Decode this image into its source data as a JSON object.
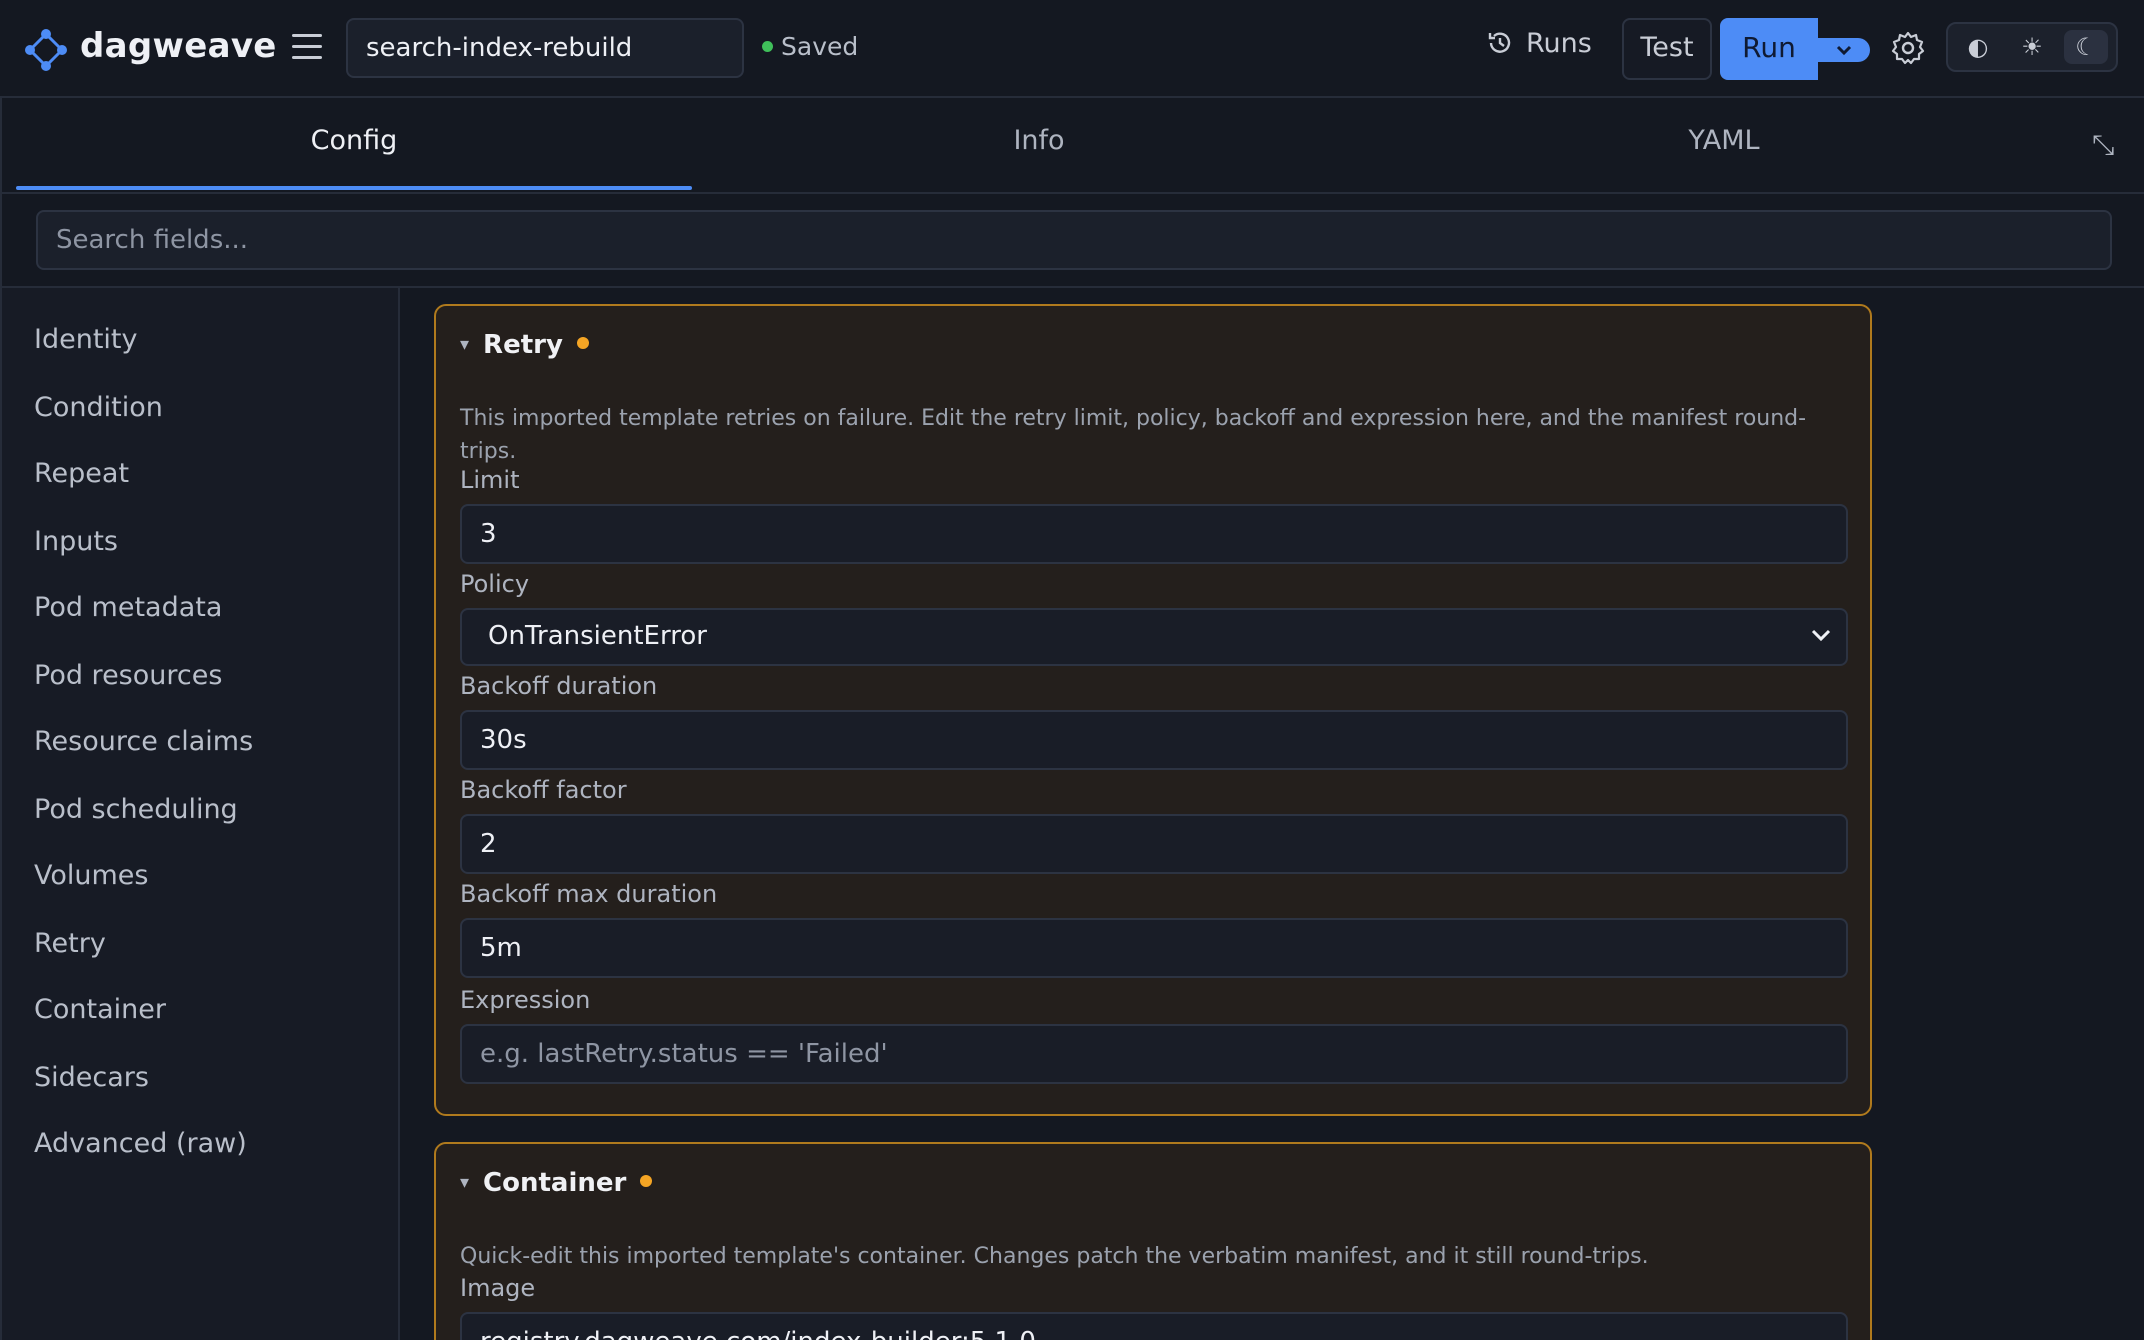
{
  "app": {
    "brand": "dagweave",
    "workflow_name": "search-index-rebuild",
    "save_status": "Saved",
    "accent": "#4d8cf6",
    "status_ok_color": "#3fbf5a",
    "modified_color": "#f5a524"
  },
  "toolbar": {
    "runs_label": "Runs",
    "test_label": "Test",
    "run_label": "Run",
    "theme_options": [
      "◐",
      "☀",
      "☾"
    ],
    "theme_active_index": 2
  },
  "tabs": [
    {
      "label": "Config",
      "active": true
    },
    {
      "label": "Info",
      "active": false
    },
    {
      "label": "YAML",
      "active": false
    }
  ],
  "collapse_icon": "⤡",
  "search": {
    "placeholder": "Search fields..."
  },
  "sidebar": {
    "items": [
      {
        "label": "Identity"
      },
      {
        "label": "Condition"
      },
      {
        "label": "Repeat"
      },
      {
        "label": "Inputs"
      },
      {
        "label": "Pod metadata"
      },
      {
        "label": "Pod resources"
      },
      {
        "label": "Resource claims"
      },
      {
        "label": "Pod scheduling"
      },
      {
        "label": "Volumes"
      },
      {
        "label": "Retry"
      },
      {
        "label": "Container"
      },
      {
        "label": "Sidecars"
      },
      {
        "label": "Advanced (raw)"
      }
    ]
  },
  "retry": {
    "title": "Retry",
    "caret": "▾",
    "description": "This imported template retries on failure. Edit the retry limit, policy, backoff and expression here, and the manifest round-trips.",
    "limit_label": "Limit",
    "limit_value": "3",
    "policy_label": "Policy",
    "policy_value": "OnTransientError",
    "backoff_duration_label": "Backoff duration",
    "backoff_duration_value": "30s",
    "backoff_factor_label": "Backoff factor",
    "backoff_factor_value": "2",
    "backoff_max_label": "Backoff max duration",
    "backoff_max_value": "5m",
    "expression_label": "Expression",
    "expression_placeholder": "e.g. lastRetry.status == 'Failed'"
  },
  "container": {
    "title": "Container",
    "caret": "▾",
    "description": "Quick-edit this imported template's container. Changes patch the verbatim manifest, and it still round-trips.",
    "image_label": "Image",
    "image_value": "registry.dagweave.com/index-builder:5.1.0"
  }
}
